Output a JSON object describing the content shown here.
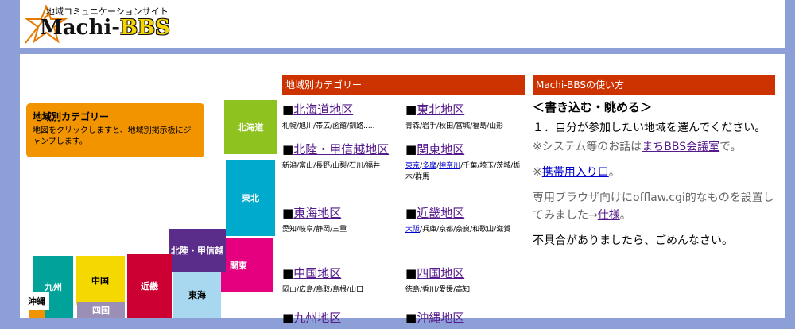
{
  "header": {
    "subtitle": "地域コミュニケーションサイト",
    "logo_prefix": "Machi-",
    "logo_suffix": "BBS"
  },
  "map": {
    "info_title": "地域別カテゴリー",
    "info_text": "地図をクリックしますと、地域別掲示板にジャンプします。",
    "regions": {
      "hokkaido": "北海道",
      "tohoku": "東北",
      "hokuriku": "北陸・甲信越",
      "kanto": "関東",
      "tokai": "東海",
      "kinki": "近畿",
      "chugoku": "中国",
      "shikoku": "四国",
      "kyushu": "九州",
      "okinawa": "沖縄"
    }
  },
  "categories": {
    "header": "地域別カテゴリー",
    "bullet": "■",
    "items": [
      {
        "title": "北海道地区",
        "sub": "札幌/旭川/帯広/函館/釧路....."
      },
      {
        "title": "東北地区",
        "sub": "青森/岩手/秋田/宮城/福島/山形"
      },
      {
        "title": "北陸・甲信越地区",
        "sub": "新潟/富山/長野/山梨/石川/福井"
      },
      {
        "title": "関東地区",
        "sub_links": [
          "東京",
          "多摩",
          "神奈川"
        ],
        "sub": "千葉/埼玉/茨城/栃木/群馬"
      },
      {
        "title": "東海地区",
        "sub": "愛知/岐阜/静岡/三重"
      },
      {
        "title": "近畿地区",
        "sub_links": [
          "大阪"
        ],
        "sub": "兵庫/京都/奈良/和歌山/滋賀"
      },
      {
        "title": "中国地区",
        "sub": "岡山/広島/鳥取/島根/山口"
      },
      {
        "title": "四国地区",
        "sub": "徳島/香川/愛媛/高知"
      },
      {
        "title": "九州地区",
        "sub": ""
      },
      {
        "title": "沖縄地区",
        "sub": ""
      }
    ]
  },
  "howto": {
    "header": "Machi-BBSの使い方",
    "heading": "＜書き込む・眺める＞",
    "step1": "１．自分が参加したい地域を選んでください。",
    "note_prefix": "※システム等のお話は",
    "note_link": "まちBBS会議室",
    "note_suffix": "で。",
    "mobile_prefix": "※",
    "mobile_link": "携帯用入り口",
    "mobile_suffix": "。",
    "browser_text": "専用ブラウザ向けにofflaw.cgi的なものを設置してみました→",
    "browser_link": "仕様",
    "browser_suffix": "。",
    "apology": "不具合がありましたら、ごめんなさい。"
  },
  "colors": {
    "background": "#8c9fd6",
    "header_bar": "#cc3300",
    "info_box": "#f29400",
    "hokkaido": "#8dc21f",
    "tohoku": "#00aacc",
    "hokuriku": "#5a2d8a",
    "kanto": "#e4007f",
    "tokai": "#a8d8f0",
    "kinki": "#cc0033",
    "chugoku": "#f5d800",
    "shikoku": "#9b8fb8",
    "kyushu": "#00a29a",
    "okinawa": "#f29400"
  }
}
